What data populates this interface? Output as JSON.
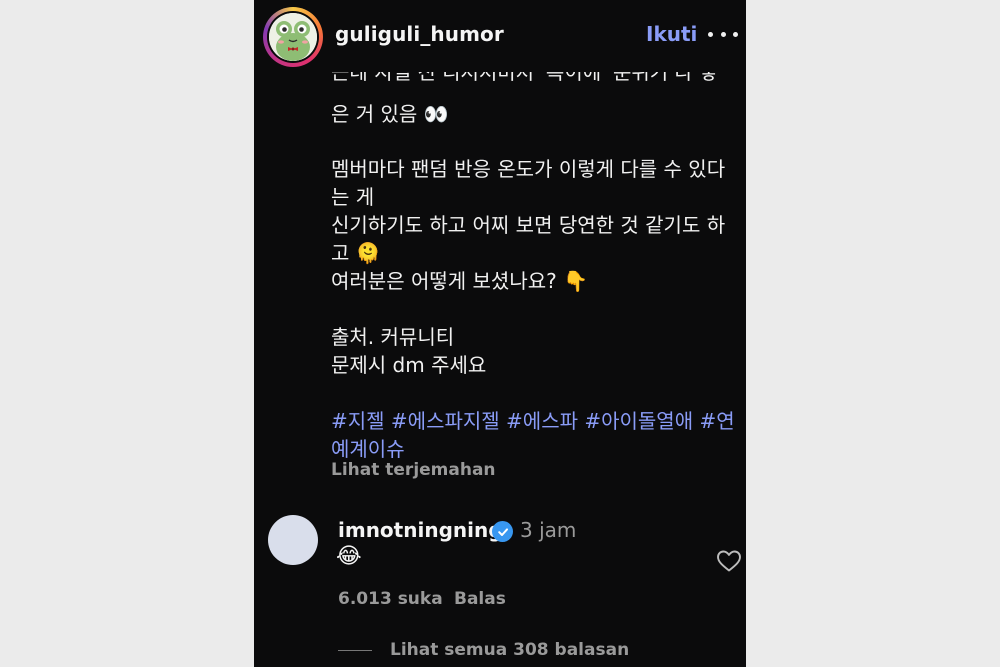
{
  "post": {
    "username": "guliguli_humor",
    "follow_label": "Ikuti",
    "more_icon": "more-horizontal-icon"
  },
  "caption": {
    "partial_line": "근데 지젤 진 디저처미처 '특이에' 분위기 다 낳",
    "lines": [
      "은 거 있음 👀",
      "멤버마다 팬덤 반응 온도가 이렇게 다를 수 있다",
      "는 게",
      "신기하기도 하고 어찌 보면 당연한 것 같기도 하",
      "고 🫠",
      "여러분은 어떻게 보셨나요? 👇",
      "출처. 커뮤니티",
      "문제시 dm 주세요"
    ],
    "hashtags_line1": "#지젤 #에스파지젤 #에스파 #아이돌열애 #연",
    "hashtags_line2": "예계이슈",
    "translate": "Lihat terjemahan"
  },
  "comment": {
    "username": "imnotningning",
    "verified_icon": "verified-badge-icon",
    "time": "3 jam",
    "text": "😂",
    "likes": "6.013 suka",
    "reply_label": "Balas",
    "view_replies": "Lihat semua 308 balasan",
    "heart_icon": "heart-outline-icon"
  },
  "colors": {
    "background": "#0b0b0c",
    "accent": "#8a9cf7",
    "muted": "#9a9a9a",
    "verified": "#3897f0"
  }
}
